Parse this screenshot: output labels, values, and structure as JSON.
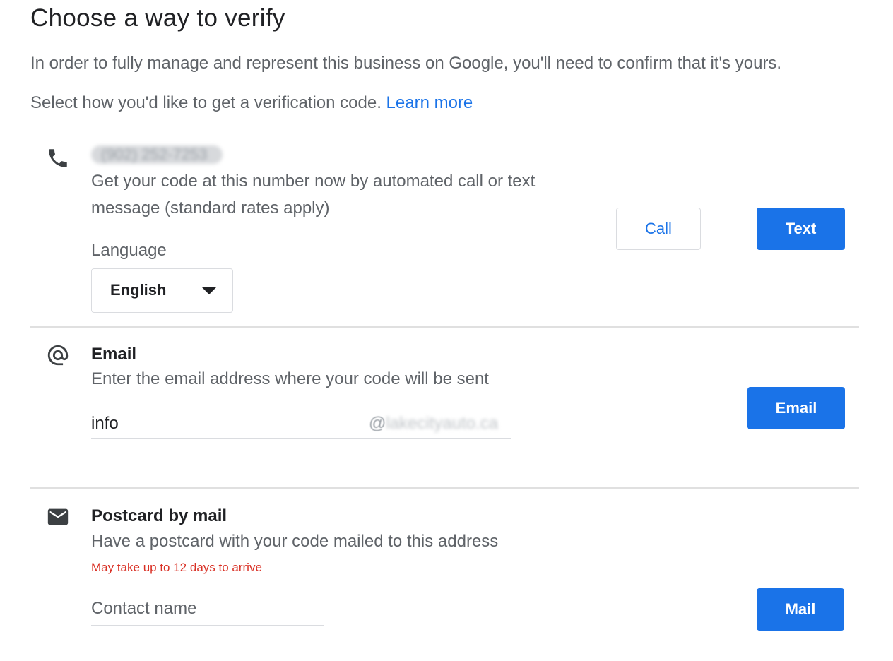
{
  "page": {
    "title": "Choose a way to verify",
    "intro": "In order to fully manage and represent this business on Google, you'll need to confirm that it's yours.",
    "select_prompt": "Select how you'd like to get a verification code.",
    "learn_more": "Learn more"
  },
  "phone": {
    "icon": "phone-icon",
    "number": "(902) 252-7253",
    "description": "Get your code at this number now by automated call or text message (standard rates apply)",
    "language_label": "Language",
    "language_value": "English",
    "call_button": "Call",
    "text_button": "Text"
  },
  "email": {
    "icon": "at-sign-icon",
    "label": "Email",
    "description": "Enter the email address where your code will be sent",
    "local_part": "info",
    "domain_prefix": "@",
    "domain": "lakecityauto.ca",
    "button": "Email"
  },
  "mail": {
    "icon": "envelope-icon",
    "label": "Postcard by mail",
    "description": "Have a postcard with your code mailed to this address",
    "warning": "May take up to 12 days to arrive",
    "contact_placeholder": "Contact name",
    "button": "Mail"
  },
  "colors": {
    "accent": "#1a73e8",
    "warning": "#d93025",
    "secondary_text": "#5f6368"
  }
}
